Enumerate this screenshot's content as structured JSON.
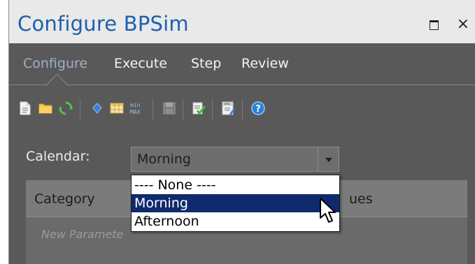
{
  "window": {
    "title": "Configure BPSim",
    "maximize_glyph": "maximize-icon",
    "close_glyph": "×"
  },
  "tabs": [
    {
      "label": "Configure",
      "active": true
    },
    {
      "label": "Execute",
      "active": false
    },
    {
      "label": "Step",
      "active": false
    },
    {
      "label": "Review",
      "active": false
    }
  ],
  "toolbar": {
    "icons": [
      "new-document-icon",
      "open-folder-icon",
      "refresh-icon",
      "parameter-icon",
      "table-icon",
      "min-max-icon",
      "save-icon",
      "validate-icon",
      "xml-export-icon",
      "help-icon"
    ]
  },
  "calendar": {
    "label": "Calendar:",
    "selected": "Morning",
    "options": [
      "---- None ----",
      "Morning",
      "Afternoon"
    ],
    "highlighted_index": 1
  },
  "grid": {
    "columns": [
      "Category",
      "ues"
    ],
    "new_row_placeholder": "New Paramete"
  },
  "colors": {
    "title": "#1f5fae",
    "active_tab": "#9fb0c7",
    "selection": "#102a6e",
    "panel_bg": "#595959"
  }
}
